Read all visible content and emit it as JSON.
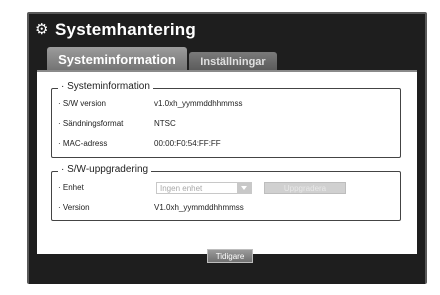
{
  "window": {
    "title": "Systemhantering"
  },
  "tabs": [
    {
      "label": "Systeminformation",
      "active": true
    },
    {
      "label": "Inställningar",
      "active": false
    }
  ],
  "system_info": {
    "title": "Systeminformation",
    "rows": [
      {
        "label": "· S/W version",
        "value": "v1.0xh_yymmddhhmmss"
      },
      {
        "label": "· Sändningsformat",
        "value": "NTSC"
      },
      {
        "label": "· MAC-adress",
        "value": "00:00:F0:54:FF:FF"
      }
    ]
  },
  "sw_upgrade": {
    "title": "S/W-uppgradering",
    "device_label": "· Enhet",
    "device_value": "Ingen enhet",
    "upgrade_button": "Uppgradera",
    "version_label": "· Version",
    "version_value": "V1.0xh_yymmddhhmmss"
  },
  "footer": {
    "back_label": "Tidigare"
  },
  "colors": {
    "window_bg": "#1e1e1e",
    "panel_bg": "#ffffff",
    "tab_active": "#8a8a8a"
  },
  "icons": {
    "title_icon": "gear-icon"
  }
}
